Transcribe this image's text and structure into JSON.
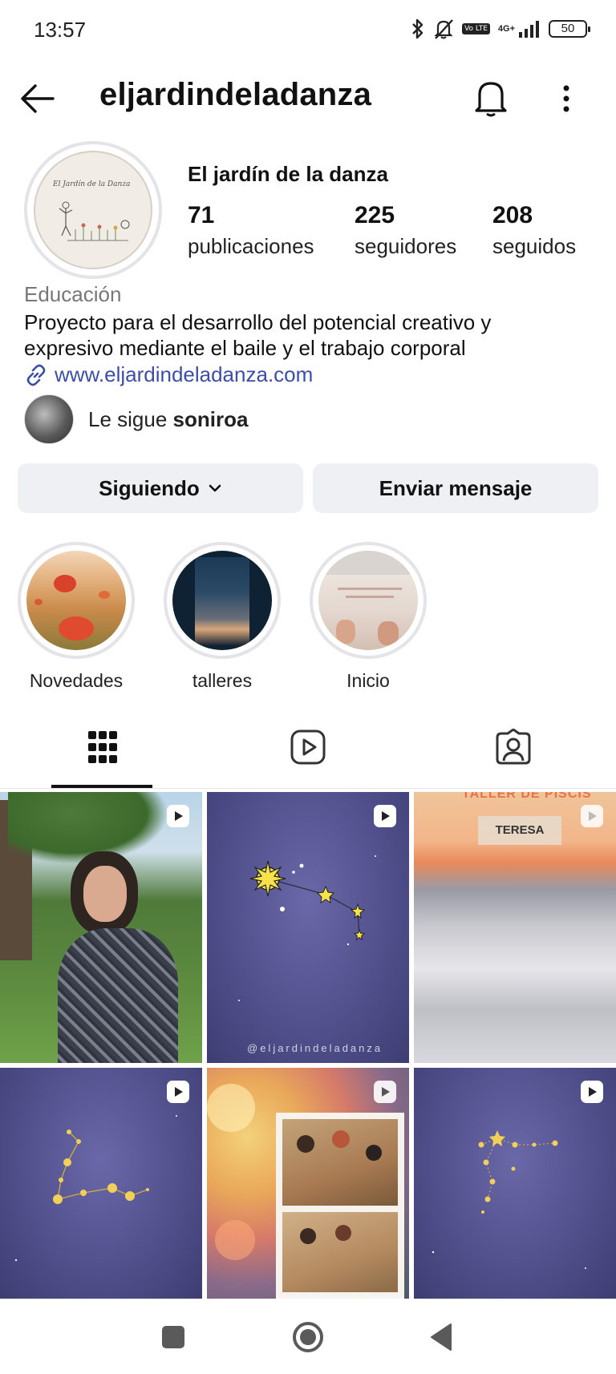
{
  "status_bar": {
    "time": "13:57",
    "network": "4G+",
    "volte": "Vo LTE",
    "battery": "50"
  },
  "header": {
    "username": "eljardindeladanza"
  },
  "profile": {
    "display_name": "El jardín de la danza",
    "stats": [
      {
        "value": "71",
        "label": "publicaciones"
      },
      {
        "value": "225",
        "label": "seguidores"
      },
      {
        "value": "208",
        "label": "seguidos"
      }
    ],
    "category": "Educación",
    "bio": "Proyecto para el desarrollo del potencial creativo y expresivo mediante el baile y el trabajo corporal",
    "link": "www.eljardindeladanza.com",
    "followed_by_prefix": "Le sigue ",
    "followed_by_user": "soniroa"
  },
  "actions": {
    "following_label": "Siguiendo",
    "message_label": "Enviar mensaje"
  },
  "highlights": [
    {
      "label": "Novedades"
    },
    {
      "label": "talleres"
    },
    {
      "label": "Inicio"
    }
  ],
  "grid": {
    "watermark": "@eljardindeladanza",
    "taller_text": "TALLER DE PISCIS",
    "teresa_text": "TERESA"
  },
  "colors": {
    "link": "#3b4fa8",
    "button_bg": "#eff0f4",
    "ring": "#e3e3e8"
  }
}
